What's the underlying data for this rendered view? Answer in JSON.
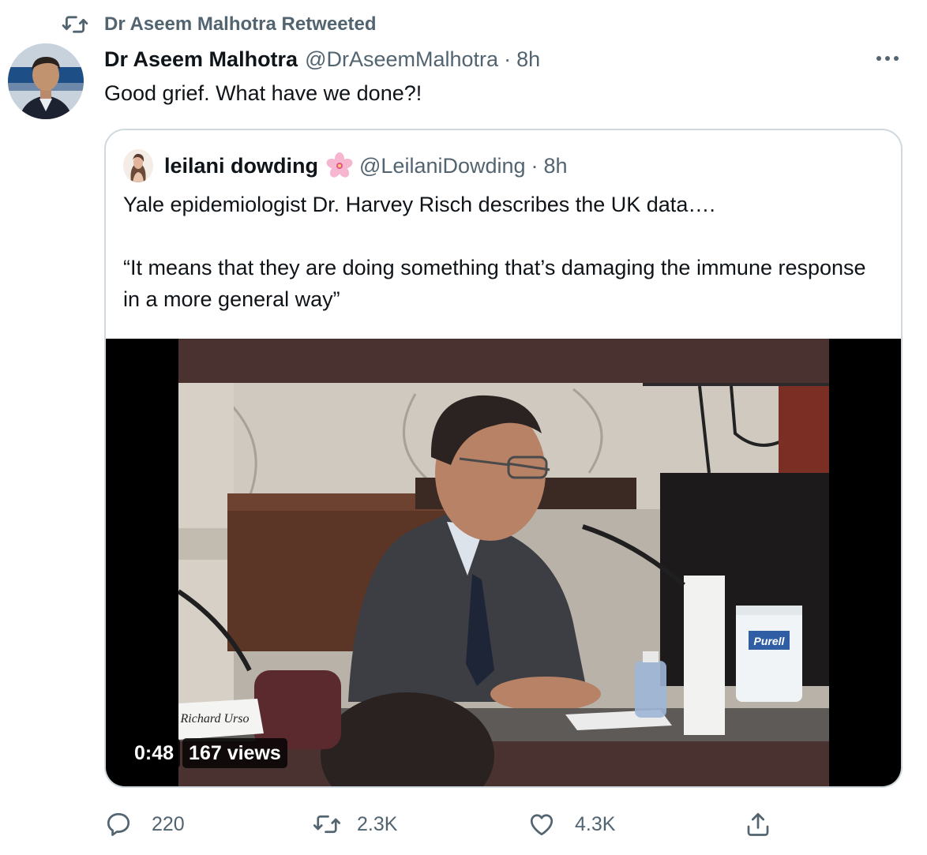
{
  "retweet": {
    "icon": "retweet-icon",
    "label": "Dr Aseem Malhotra Retweeted"
  },
  "tweet": {
    "avatar": "avatar-photo",
    "name": "Dr Aseem Malhotra",
    "handle": "@DrAseemMalhotra",
    "separator": "·",
    "time": "8h",
    "text": "Good grief. What have we done?!",
    "more_icon": "more-icon"
  },
  "quote": {
    "avatar": "avatar-photo",
    "name": "leilani dowding",
    "emoji": "cherry-blossom-icon",
    "handle": "@LeilaniDowding",
    "separator": "·",
    "time": "8h",
    "paragraphs": [
      "Yale epidemiologist Dr. Harvey Risch describes the UK data….",
      "“It means that they are doing something that’s damaging the immune response in a more general way”"
    ],
    "video": {
      "duration": "0:48",
      "views": "167 views",
      "nameplate": "Richard Urso",
      "bottle_label": "Purell"
    }
  },
  "actions": {
    "reply": {
      "icon": "reply-icon",
      "count": "220"
    },
    "retweet": {
      "icon": "retweet-icon",
      "count": "2.3K"
    },
    "like": {
      "icon": "heart-icon",
      "count": "4.3K"
    },
    "share": {
      "icon": "share-icon"
    }
  },
  "colors": {
    "text": "#0f1419",
    "secondary": "#536471",
    "border": "#cfd9de"
  }
}
